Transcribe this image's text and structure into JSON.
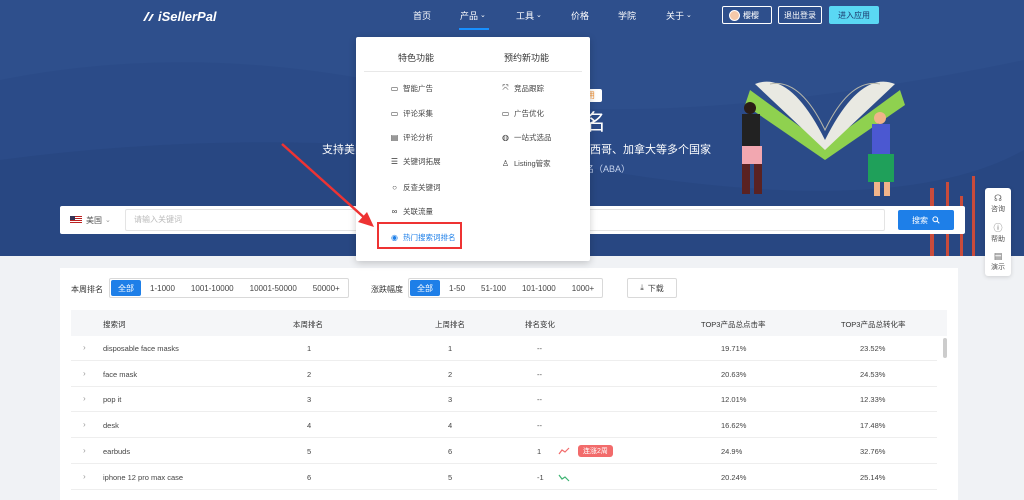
{
  "brand": {
    "name": "iSellerPal"
  },
  "nav": {
    "items": [
      "首页",
      "产品",
      "工具",
      "价格",
      "学院",
      "关于"
    ],
    "user_name": "樱樱",
    "logout": "退出登录",
    "enter_app": "进入应用"
  },
  "hero": {
    "tag": "用",
    "title_char": "名",
    "sub_left": "支持美国",
    "sub_right": "西哥、加拿大等多个国家",
    "sub_aba": "名（ABA）"
  },
  "search": {
    "country": "美国",
    "placeholder": "请输入关键词",
    "button": "搜索"
  },
  "dropdown": {
    "col1_title": "特色功能",
    "col2_title": "预约新功能",
    "col1_items": [
      "智能广告",
      "评论采集",
      "评论分析",
      "关键词拓展",
      "反查关键词",
      "关联流量",
      "热门搜索词排名"
    ],
    "col2_items": [
      "竞品跟踪",
      "广告优化",
      "一站式选品",
      "Listing管家"
    ]
  },
  "side": {
    "items": [
      "咨询",
      "帮助",
      "演示"
    ]
  },
  "filters": {
    "rank_label": "本周排名",
    "rank_options": [
      "全部",
      "1-1000",
      "1001-10000",
      "10001-50000",
      "50000+"
    ],
    "change_label": "涨跌幅度",
    "change_options": [
      "全部",
      "1-50",
      "51-100",
      "101-1000",
      "1000+"
    ],
    "download": "下载"
  },
  "table": {
    "headers": [
      "搜索词",
      "本周排名",
      "上周排名",
      "排名变化",
      "TOP3产品总点击率",
      "TOP3产品总转化率"
    ],
    "rows": [
      {
        "term": "disposable face masks",
        "this_week": "1",
        "last_week": "1",
        "change": "--",
        "ctr": "19.71%",
        "cvr": "23.52%",
        "badge": ""
      },
      {
        "term": "face mask",
        "this_week": "2",
        "last_week": "2",
        "change": "--",
        "ctr": "20.63%",
        "cvr": "24.53%",
        "badge": ""
      },
      {
        "term": "pop it",
        "this_week": "3",
        "last_week": "3",
        "change": "--",
        "ctr": "12.01%",
        "cvr": "12.33%",
        "badge": ""
      },
      {
        "term": "desk",
        "this_week": "4",
        "last_week": "4",
        "change": "--",
        "ctr": "16.62%",
        "cvr": "17.48%",
        "badge": ""
      },
      {
        "term": "earbuds",
        "this_week": "5",
        "last_week": "6",
        "change": "1",
        "ctr": "24.9%",
        "cvr": "32.76%",
        "badge": "连涨2周"
      },
      {
        "term": "iphone 12 pro max case",
        "this_week": "6",
        "last_week": "5",
        "change": "-1",
        "ctr": "20.24%",
        "cvr": "25.14%",
        "badge": ""
      }
    ]
  },
  "colors": {
    "hero_bg": "#2e4f8c",
    "primary": "#1e7fe8",
    "highlight": "#ee3333",
    "badge": "#f26b6b"
  }
}
